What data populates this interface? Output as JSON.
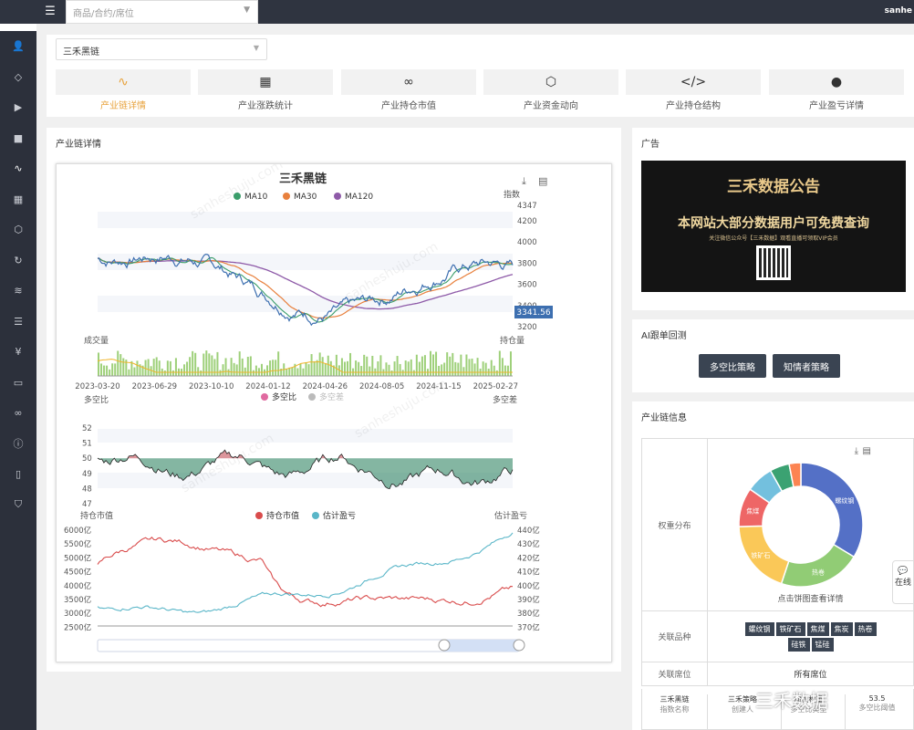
{
  "header": {
    "search_placeholder": "商品/合约/席位",
    "user": "sanhe"
  },
  "sidebar": {
    "icons": [
      "user-icon",
      "diamond-icon",
      "play-circle-icon",
      "comment-icon",
      "pulse-icon",
      "calendar-check-icon",
      "cube-icon",
      "refresh-icon",
      "layers-icon",
      "list-icon",
      "yen-icon",
      "video-icon",
      "link-icon",
      "info-icon",
      "file-icon",
      "shield-icon"
    ]
  },
  "chain_select": "三禾黑链",
  "tabs": [
    {
      "label": "产业链详情",
      "icon": "pulse-icon"
    },
    {
      "label": "产业涨跌统计",
      "icon": "table-icon"
    },
    {
      "label": "产业持仓市值",
      "icon": "infinity-icon"
    },
    {
      "label": "产业资金动向",
      "icon": "cube-icon"
    },
    {
      "label": "产业持仓结构",
      "icon": "code-icon"
    },
    {
      "label": "产业盈亏详情",
      "icon": "compass-icon"
    }
  ],
  "main": {
    "title": "产业链详情"
  },
  "chart_data": [
    {
      "type": "line",
      "title": "三禾黑链",
      "series": [
        {
          "name": "MA10"
        },
        {
          "name": "MA30"
        },
        {
          "name": "MA120"
        }
      ],
      "y_label": "指数",
      "y_ticks": [
        "4347",
        "4200",
        "4000",
        "3800",
        "3600",
        "3400",
        "3200"
      ],
      "last_value": "3341.56",
      "colors": [
        "#3a9d6a",
        "#e8803d",
        "#8e5aa8",
        "#3d6fb0"
      ]
    },
    {
      "type": "bar",
      "left_label": "成交量",
      "right_label": "持仓量",
      "x_ticks": [
        "2023-03-20",
        "2023-06-29",
        "2023-10-10",
        "2024-01-12",
        "2024-04-26",
        "2024-08-05",
        "2024-11-15",
        "2025-02-27"
      ]
    },
    {
      "type": "area",
      "left_label": "多空比",
      "right_label": "多空差",
      "series": [
        {
          "name": "多空比"
        },
        {
          "name": "多空差"
        }
      ],
      "y_ticks": [
        "52",
        "51",
        "50",
        "49",
        "48",
        "47"
      ],
      "colors": [
        "#c0404b",
        "#1f7a55"
      ]
    },
    {
      "type": "line",
      "left_label": "持仓市值",
      "right_label": "估计盈亏",
      "series": [
        {
          "name": "持仓市值"
        },
        {
          "name": "估计盈亏"
        }
      ],
      "y_ticks_left": [
        "6000亿",
        "5500亿",
        "5000亿",
        "4500亿",
        "4000亿",
        "3500亿",
        "3000亿",
        "2500亿"
      ],
      "y_ticks_right": [
        "440亿",
        "430亿",
        "420亿",
        "410亿",
        "400亿",
        "390亿",
        "380亿",
        "370亿"
      ],
      "colors": [
        "#d94c4c",
        "#5ab6c8"
      ]
    },
    {
      "type": "pie",
      "title": "权重分布",
      "slices": [
        {
          "name": "螺纹钢",
          "value": 33,
          "color": "#5470c6"
        },
        {
          "name": "热卷",
          "value": 21,
          "color": "#91cc75"
        },
        {
          "name": "铁矿石",
          "value": 19,
          "color": "#fac858"
        },
        {
          "name": "焦煤",
          "value": 10,
          "color": "#ee6666"
        },
        {
          "name": "",
          "value": 7,
          "color": "#73c0de"
        },
        {
          "name": "",
          "value": 5,
          "color": "#3ba272"
        },
        {
          "name": "",
          "value": 3,
          "color": "#fc8452"
        }
      ],
      "caption": "点击饼图查看详情"
    }
  ],
  "watermark": "sanheshuju.com",
  "ad": {
    "title": "广告",
    "banner_title": "三禾数据公告",
    "banner_line1": "本网站大部分数据用户可免费查询",
    "banner_line2": "关注微信公众号【三禾数据】观看直播可领取VIP会员"
  },
  "ai": {
    "title": "AI跟单回测",
    "btn1": "多空比策略",
    "btn2": "知情者策略"
  },
  "info": {
    "title": "产业链信息",
    "row_weight": "权重分布",
    "row_varieties": "关联品种",
    "varieties": [
      "螺纹钢",
      "铁矿石",
      "焦煤",
      "焦炭",
      "热卷",
      "硅铁",
      "锰硅"
    ],
    "row_seat": "关联席位",
    "seat_value": "所有席位",
    "bottom": {
      "name": "三禾黑链",
      "name_sub": "指数名称",
      "strategy": "三禾策略",
      "strategy_sub": "创建人",
      "weight": "加权权重",
      "weight_sub": "多空比类型",
      "value": "53.5",
      "value_sub": "多空比阈值"
    }
  },
  "chat": "在线",
  "brand": "三禾数据"
}
